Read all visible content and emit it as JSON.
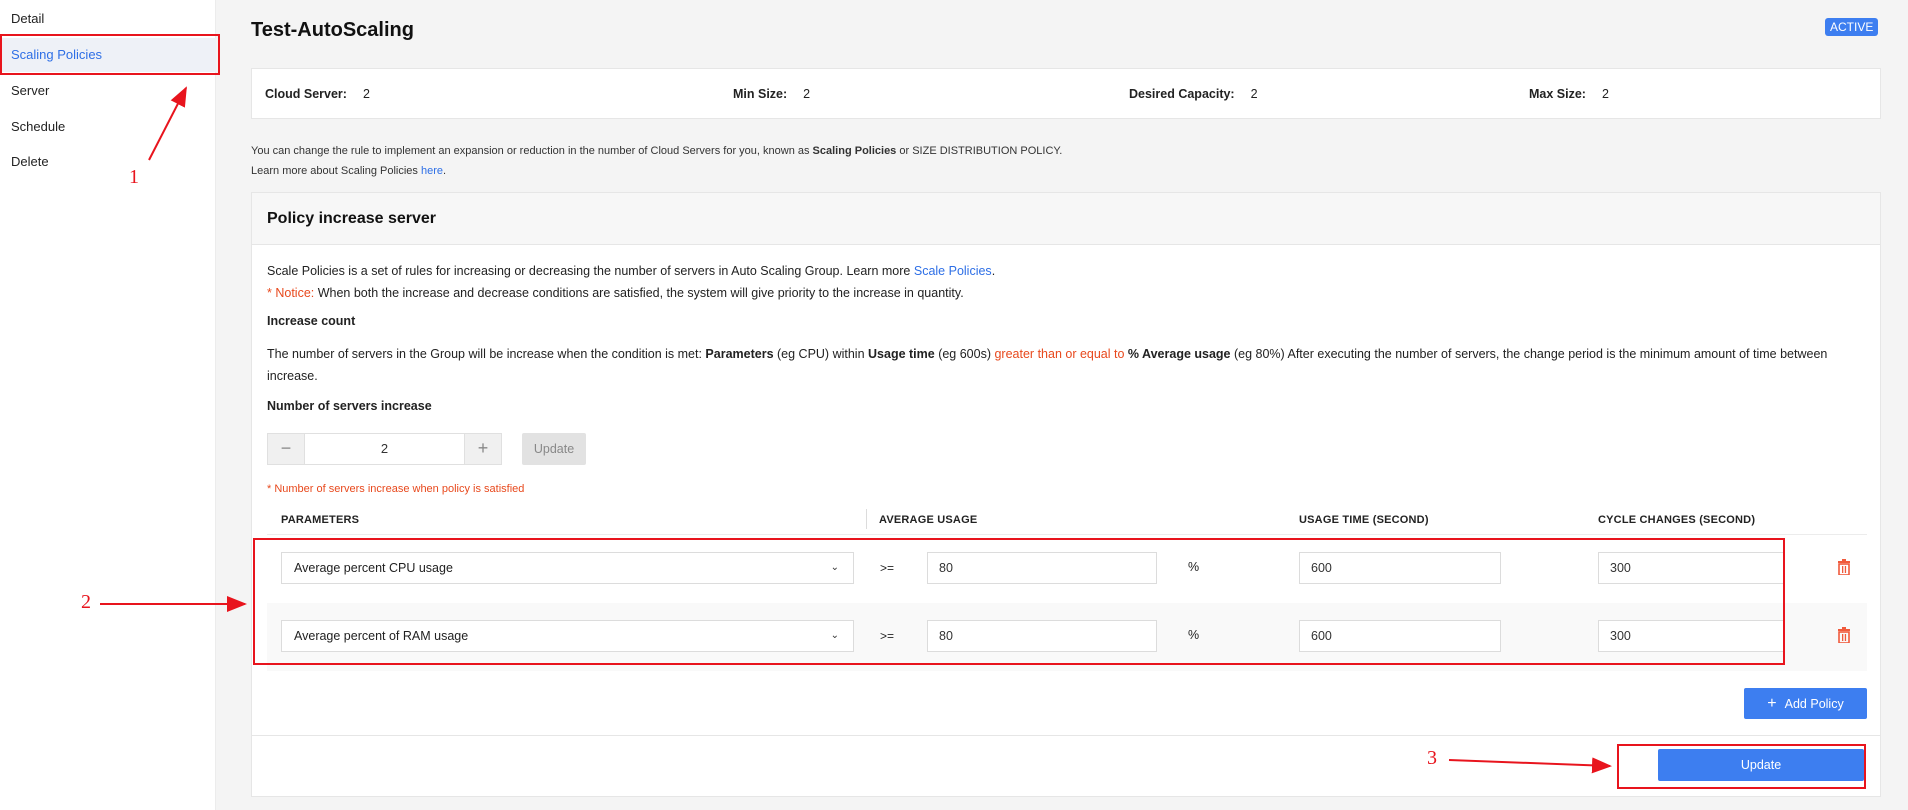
{
  "sidebar": {
    "items": [
      {
        "label": "Detail"
      },
      {
        "label": "Scaling Policies"
      },
      {
        "label": "Server"
      },
      {
        "label": "Schedule"
      },
      {
        "label": "Delete"
      }
    ]
  },
  "header": {
    "title": "Test-AutoScaling",
    "status": "ACTIVE"
  },
  "summary": {
    "cloud_server_label": "Cloud Server:",
    "cloud_server_value": "2",
    "min_size_label": "Min Size:",
    "min_size_value": "2",
    "desired_label": "Desired Capacity:",
    "desired_value": "2",
    "max_size_label": "Max Size:",
    "max_size_value": "2"
  },
  "intro": {
    "line1_prefix": "You can change the rule to implement an expansion or reduction in the number of Cloud Servers for you, known as ",
    "line1_bold": "Scaling Policies",
    "line1_suffix": " or SIZE DISTRIBUTION POLICY.",
    "line2_prefix": "Learn more about Scaling Policies ",
    "line2_link": "here",
    "line2_suffix": "."
  },
  "policy": {
    "title": "Policy increase server",
    "desc_prefix": "Scale Policies is a set of rules for increasing or decreasing the number of servers in Auto Scaling Group. Learn more ",
    "desc_link": "Scale Policies",
    "desc_suffix": ".",
    "notice_label": "* Notice:",
    "notice_text": " When both the increase and decrease conditions are satisfied, the system will give priority to the increase in quantity.",
    "increase_count_label": "Increase count",
    "rule_1": "The number of servers in the Group will be increase when the condition is met: ",
    "rule_b1": "Parameters",
    "rule_2": " (eg CPU) within ",
    "rule_b2": "Usage time",
    "rule_3": " (eg 600s) ",
    "rule_red": "greater than or equal to",
    "rule_b3": " % Average usage",
    "rule_4": " (eg 80%) After executing the number of servers, the change period is the minimum amount of time between",
    "rule_5": "increase.",
    "servers_increase_label": "Number of servers increase",
    "stepper_minus": "−",
    "stepper_value": "2",
    "stepper_plus": "+",
    "update_small_label": "Update",
    "hint": "* Number of servers increase when policy is satisfied",
    "columns": {
      "parameters": "PARAMETERS",
      "average_usage": "AVERAGE USAGE",
      "usage_time": "USAGE TIME (SECOND)",
      "cycle_changes": "CYCLE CHANGES (SECOND)"
    },
    "rows": [
      {
        "parameter": "Average percent CPU usage",
        "operator": ">=",
        "average": "80",
        "unit": "%",
        "usage_time": "600",
        "cycle": "300"
      },
      {
        "parameter": "Average percent of RAM usage",
        "operator": ">=",
        "average": "80",
        "unit": "%",
        "usage_time": "600",
        "cycle": "300"
      }
    ],
    "add_policy_label": "Add Policy",
    "update_label": "Update"
  },
  "annotations": {
    "label_1": "1",
    "label_2": "2",
    "label_3": "3"
  },
  "colors": {
    "accent": "#3d7ef0",
    "annotation": "#e8141d",
    "notice": "#e8491d"
  }
}
